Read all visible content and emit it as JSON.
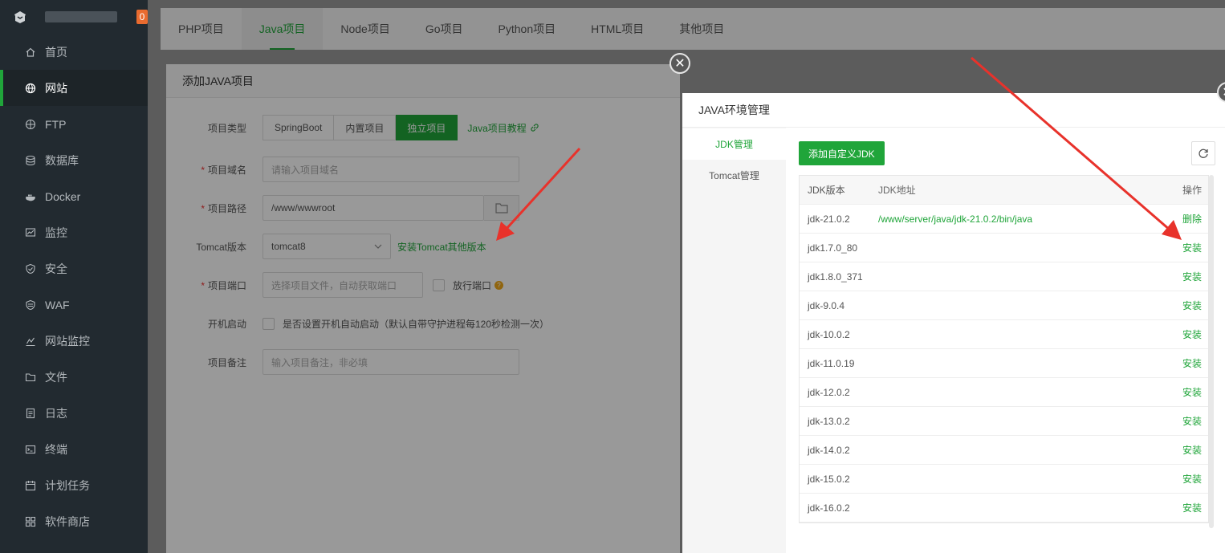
{
  "sidebar": {
    "badge": "0",
    "username": "",
    "items": [
      {
        "label": "首页",
        "icon": "home-icon"
      },
      {
        "label": "网站",
        "icon": "globe-icon"
      },
      {
        "label": "FTP",
        "icon": "ftp-globe-icon"
      },
      {
        "label": "数据库",
        "icon": "database-icon"
      },
      {
        "label": "Docker",
        "icon": "docker-icon"
      },
      {
        "label": "监控",
        "icon": "monitor-icon"
      },
      {
        "label": "安全",
        "icon": "shield-icon"
      },
      {
        "label": "WAF",
        "icon": "waf-shield-icon"
      },
      {
        "label": "网站监控",
        "icon": "chart-icon"
      },
      {
        "label": "文件",
        "icon": "folder-icon"
      },
      {
        "label": "日志",
        "icon": "log-icon"
      },
      {
        "label": "终端",
        "icon": "terminal-icon"
      },
      {
        "label": "计划任务",
        "icon": "calendar-icon"
      },
      {
        "label": "软件商店",
        "icon": "grid-icon"
      }
    ],
    "active_index": 1
  },
  "tabs": [
    "PHP项目",
    "Java项目",
    "Node项目",
    "Go项目",
    "Python项目",
    "HTML项目",
    "其他项目"
  ],
  "active_tab": 1,
  "add_project": {
    "title": "添加JAVA项目",
    "type_label": "项目类型",
    "type_options": [
      "SpringBoot",
      "内置项目",
      "独立项目"
    ],
    "tutorial_link": "Java项目教程",
    "domain_label": "项目域名",
    "domain_placeholder": "请输入项目域名",
    "path_label": "项目路径",
    "path_value": "/www/wwwroot",
    "tomcat_label": "Tomcat版本",
    "tomcat_value": "tomcat8",
    "tomcat_install_link": "安装Tomcat其他版本",
    "port_label": "项目端口",
    "port_placeholder": "选择项目文件，自动获取端口",
    "release_port_label": "放行端口",
    "autostart_label": "开机启动",
    "autostart_text": "是否设置开机自动启动（默认自带守护进程每120秒检测一次）",
    "remark_label": "项目备注",
    "remark_placeholder": "输入项目备注，非必填"
  },
  "env_dialog": {
    "title": "JAVA环境管理",
    "side_tabs": [
      "JDK管理",
      "Tomcat管理"
    ],
    "add_button": "添加自定义JDK",
    "columns": [
      "JDK版本",
      "JDK地址",
      "操作"
    ],
    "rows": [
      {
        "version": "jdk-21.0.2",
        "path": "/www/server/java/jdk-21.0.2/bin/java",
        "action": "删除"
      },
      {
        "version": "jdk1.7.0_80",
        "path": "",
        "action": "安装"
      },
      {
        "version": "jdk1.8.0_371",
        "path": "",
        "action": "安装"
      },
      {
        "version": "jdk-9.0.4",
        "path": "",
        "action": "安装"
      },
      {
        "version": "jdk-10.0.2",
        "path": "",
        "action": "安装"
      },
      {
        "version": "jdk-11.0.19",
        "path": "",
        "action": "安装"
      },
      {
        "version": "jdk-12.0.2",
        "path": "",
        "action": "安装"
      },
      {
        "version": "jdk-13.0.2",
        "path": "",
        "action": "安装"
      },
      {
        "version": "jdk-14.0.2",
        "path": "",
        "action": "安装"
      },
      {
        "version": "jdk-15.0.2",
        "path": "",
        "action": "安装"
      },
      {
        "version": "jdk-16.0.2",
        "path": "",
        "action": "安装"
      }
    ]
  },
  "colors": {
    "accent": "#20a53a",
    "sidebar_bg": "#222a30",
    "badge": "#e96b2f",
    "arrow": "#e8322b"
  }
}
